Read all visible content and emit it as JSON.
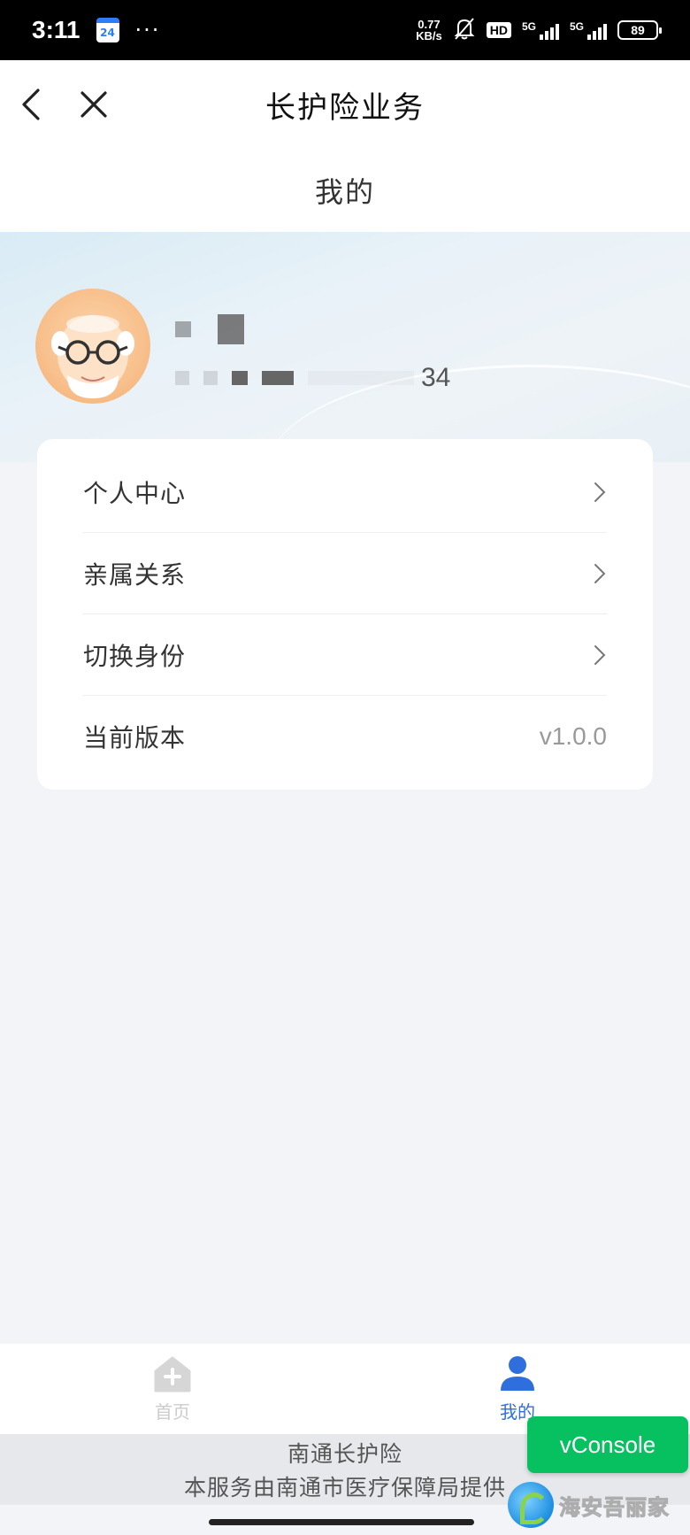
{
  "status_bar": {
    "time": "3:11",
    "calendar_day": "24",
    "more": "···",
    "net_speed_value": "0.77",
    "net_speed_unit": "KB/s",
    "hd": "HD",
    "signal1": "5G",
    "signal2": "5G",
    "battery": "89"
  },
  "nav": {
    "title": "长护险业务",
    "back_icon": "chevron-left-icon",
    "close_icon": "close-icon"
  },
  "page": {
    "title": "我的"
  },
  "profile": {
    "id_suffix": "34"
  },
  "menu": {
    "items": [
      {
        "label": "个人中心",
        "type": "link"
      },
      {
        "label": "亲属关系",
        "type": "link"
      },
      {
        "label": "切换身份",
        "type": "link"
      },
      {
        "label": "当前版本",
        "type": "value",
        "value": "v1.0.0"
      }
    ]
  },
  "tabs": [
    {
      "label": "首页",
      "icon": "home-icon",
      "active": false
    },
    {
      "label": "我的",
      "icon": "user-icon",
      "active": true
    }
  ],
  "footer": {
    "line1": "南通长护险",
    "line2": "本服务由南通市医疗保障局提供"
  },
  "vconsole": {
    "label": "vConsole"
  },
  "watermark": {
    "text": "海安吾丽家"
  },
  "colors": {
    "accent": "#2e6fdd",
    "vconsole": "#07c160",
    "inactive_tab": "#cccccc"
  }
}
